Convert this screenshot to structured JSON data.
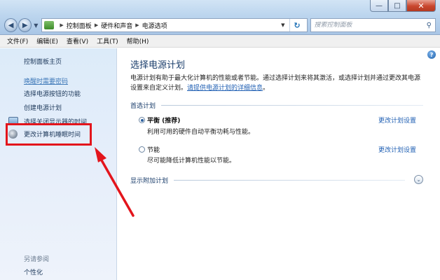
{
  "window": {
    "minimize_icon": "minimize-icon",
    "maximize_icon": "maximize-icon",
    "close_icon": "close-icon"
  },
  "nav": {
    "back_icon": "back-arrow-icon",
    "forward_icon": "forward-arrow-icon",
    "breadcrumb": [
      "控制面板",
      "硬件和声音",
      "电源选项"
    ],
    "search_placeholder": "搜索控制面板"
  },
  "menu": [
    "文件(F)",
    "编辑(E)",
    "查看(V)",
    "工具(T)",
    "帮助(H)"
  ],
  "sidebar": {
    "home": "控制面板主页",
    "items": [
      {
        "label": "唤醒时需要密码",
        "style": "hover"
      },
      {
        "label": "选择电源按钮的功能"
      },
      {
        "label": "创建电源计划"
      },
      {
        "label": "选择关闭显示器的时间",
        "icon": "monitor-icon"
      },
      {
        "label": "更改计算机睡眠时间",
        "icon": "moon-icon",
        "highlighted": true
      }
    ],
    "see_also": "另请参阅",
    "bottom_link": "个性化"
  },
  "main": {
    "title": "选择电源计划",
    "desc_before": "电源计划有助于最大化计算机的性能或者节能。通过选择计划来将其激活，或选择计划并通过更改其电源设置来自定义计划。",
    "desc_link": "请提供电源计划的详细信息",
    "desc_after": "。",
    "preferred_heading": "首选计划",
    "plans": [
      {
        "name": "平衡 (推荐)",
        "desc": "利用可用的硬件自动平衡功耗与性能。",
        "selected": true,
        "link": "更改计划设置"
      },
      {
        "name": "节能",
        "desc": "尽可能降低计算机性能以节能。",
        "selected": false,
        "link": "更改计划设置"
      }
    ],
    "additional_heading": "显示附加计划"
  },
  "colors": {
    "highlight_box": "#e3151c",
    "link": "#1f5fb3",
    "title": "#1a3d6b"
  }
}
